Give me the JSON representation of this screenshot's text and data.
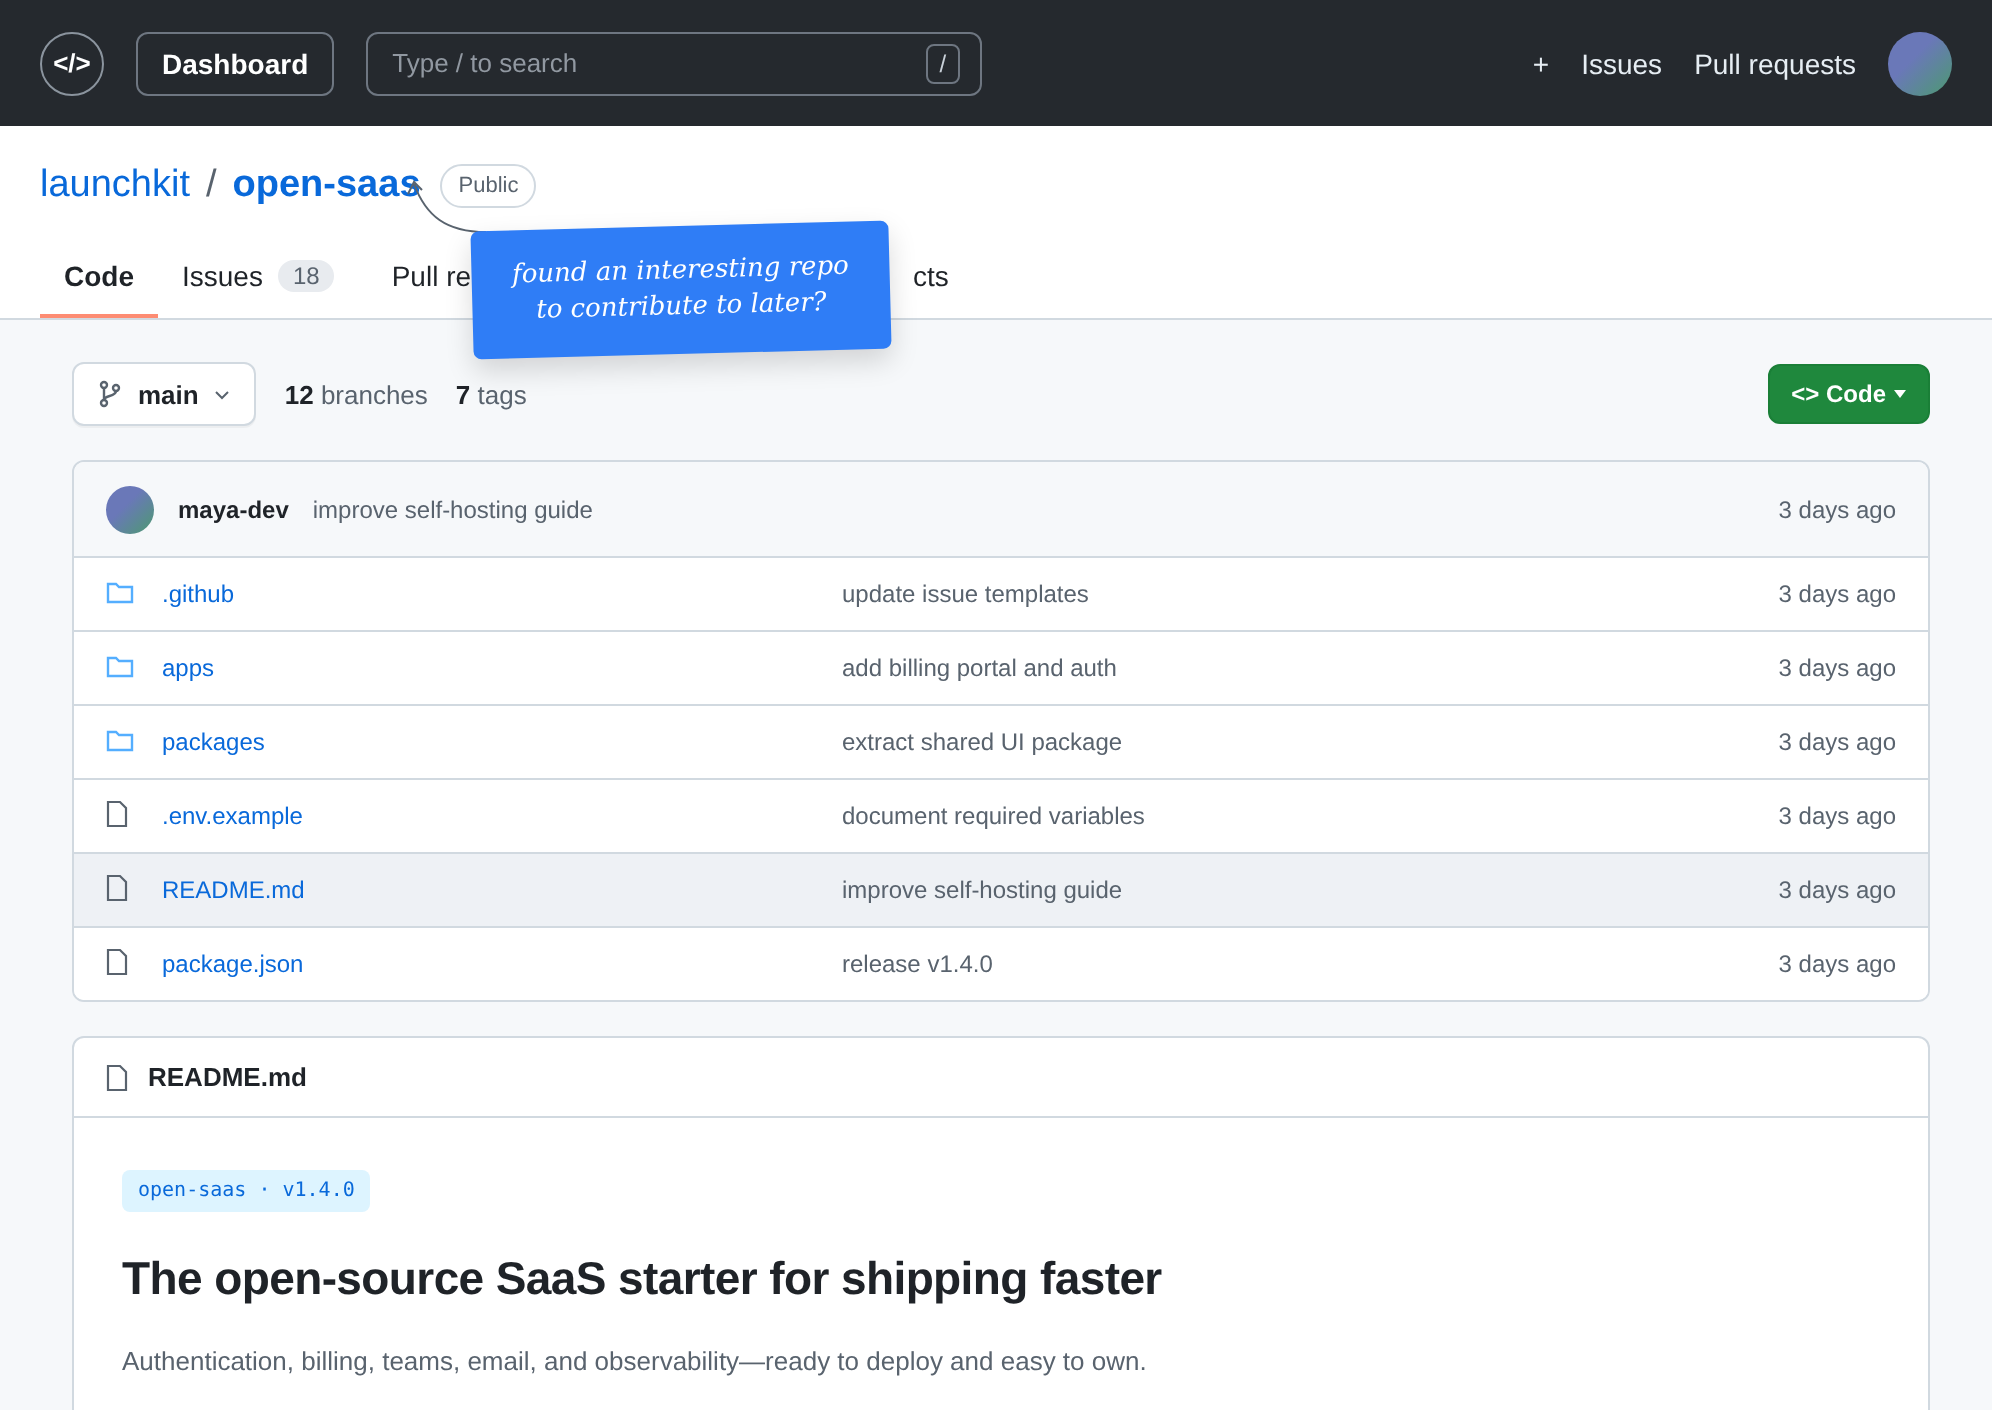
{
  "topbar": {
    "logo": "</>",
    "dashboard": "Dashboard",
    "search": {
      "placeholder": "Type / to search",
      "shortcut": "/"
    },
    "links": [
      "+",
      "Issues",
      "Pull requests"
    ]
  },
  "repo": {
    "owner": "launchkit",
    "separator": "/",
    "name": "open-saas",
    "visibility": "Public"
  },
  "tabs": [
    {
      "label": "Code",
      "selected": true
    },
    {
      "label": "Issues",
      "count": "18",
      "selected": false
    },
    {
      "label": "Pull re",
      "selected": false
    },
    {
      "label": "cts",
      "selected": false
    }
  ],
  "note": {
    "text": "found an interesting repo to contribute to later?"
  },
  "branch_bar": {
    "branch": "main",
    "branches_count": "12",
    "branches_label": "branches",
    "tags_count": "7",
    "tags_label": "tags",
    "code_button": "<> Code"
  },
  "latest_commit": {
    "author": "maya-dev",
    "message": "improve self-hosting guide",
    "time": "3 days ago"
  },
  "files": [
    {
      "kind": "folder",
      "name": ".github",
      "message": "update issue templates",
      "time": "3 days ago",
      "selected": false
    },
    {
      "kind": "folder",
      "name": "apps",
      "message": "add billing portal and auth",
      "time": "3 days ago",
      "selected": false
    },
    {
      "kind": "folder",
      "name": "packages",
      "message": "extract shared UI package",
      "time": "3 days ago",
      "selected": false
    },
    {
      "kind": "file",
      "name": ".env.example",
      "message": "document required variables",
      "time": "3 days ago",
      "selected": false
    },
    {
      "kind": "file",
      "name": "README.md",
      "message": "improve self-hosting guide",
      "time": "3 days ago",
      "selected": true
    },
    {
      "kind": "file",
      "name": "package.json",
      "message": "release v1.4.0",
      "time": "3 days ago",
      "selected": false
    }
  ],
  "readme": {
    "title": "README.md",
    "badge": "open-saas · v1.4.0",
    "heading": "The open-source SaaS starter for shipping faster",
    "description": "Authentication, billing, teams, email, and observability—ready to deploy and easy to own."
  }
}
